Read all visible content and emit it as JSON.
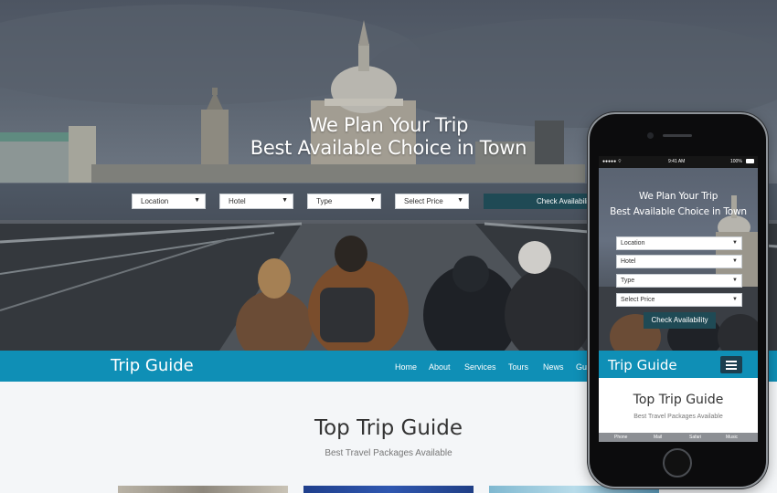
{
  "hero": {
    "title_line1": "We Plan Your Trip",
    "title_line2": "Best Available Choice in Town",
    "search": {
      "location": "Location",
      "hotel": "Hotel",
      "type": "Type",
      "price": "Select Price",
      "button": "Check Availability"
    }
  },
  "navbar": {
    "brand": "Trip Guide",
    "items": [
      "Home",
      "About",
      "Services",
      "Tours",
      "News",
      "Gu"
    ]
  },
  "section": {
    "title": "Top Trip Guide",
    "subtitle": "Best Travel Packages Available"
  },
  "phone": {
    "status_time": "9:41 AM",
    "status_battery": "100%",
    "title_line1": "We Plan Your Trip",
    "title_line2": "Best Available Choice in Town",
    "selects": [
      "Location",
      "Hotel",
      "Type",
      "Select Price"
    ],
    "button": "Check Availability",
    "brand": "Trip Guide",
    "section_title": "Top Trip Guide",
    "section_subtitle": "Best Travel Packages Available",
    "tabs": [
      "Phone",
      "Mail",
      "Safari",
      "Music"
    ]
  },
  "colors": {
    "accent": "#0f8fb6",
    "dark_button": "#1f4a55"
  }
}
